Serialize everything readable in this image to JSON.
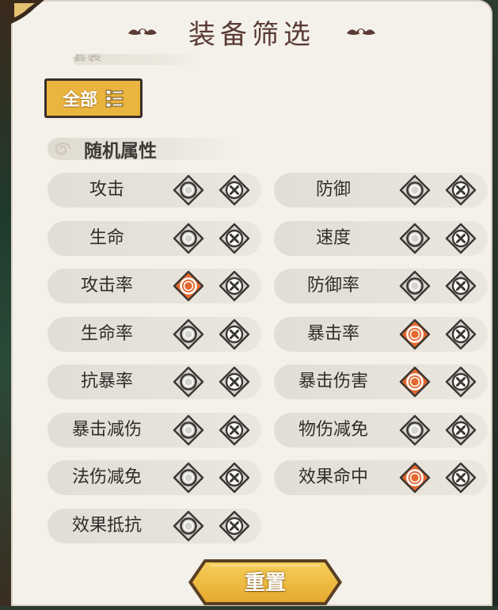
{
  "header": {
    "title": "装备筛选"
  },
  "hidden_section": {
    "label": "套装"
  },
  "filter_all": {
    "label": "全部"
  },
  "random_attributes": {
    "title": "随机属性",
    "items": [
      {
        "label": "攻击",
        "selected": false
      },
      {
        "label": "防御",
        "selected": false
      },
      {
        "label": "生命",
        "selected": false
      },
      {
        "label": "速度",
        "selected": false
      },
      {
        "label": "攻击率",
        "selected": true
      },
      {
        "label": "防御率",
        "selected": false
      },
      {
        "label": "生命率",
        "selected": false
      },
      {
        "label": "暴击率",
        "selected": true
      },
      {
        "label": "抗暴率",
        "selected": false
      },
      {
        "label": "暴击伤害",
        "selected": true
      },
      {
        "label": "暴击减伤",
        "selected": false
      },
      {
        "label": "物伤减免",
        "selected": false
      },
      {
        "label": "法伤减免",
        "selected": false
      },
      {
        "label": "效果命中",
        "selected": true
      },
      {
        "label": "效果抵抗",
        "selected": false
      }
    ]
  },
  "footer": {
    "reset_label": "重置"
  },
  "colors": {
    "panel_bg": "#f4f1ea",
    "selected_orange": "#e3682f",
    "unselected_gray": "#d6d4d0",
    "button_gold": "#e9b53e",
    "title_brown": "#5a3b34"
  }
}
